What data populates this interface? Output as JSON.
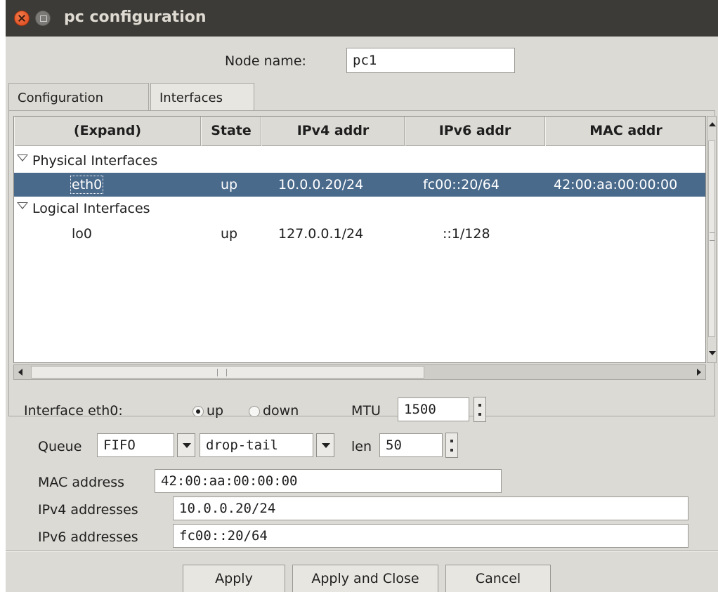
{
  "window": {
    "title": "pc configuration"
  },
  "node_name": {
    "label": "Node name:",
    "value": "pc1"
  },
  "tabs": [
    {
      "label": "Configuration",
      "selected": false
    },
    {
      "label": "Interfaces",
      "selected": true
    }
  ],
  "table": {
    "columns": [
      "(Expand)",
      "State",
      "IPv4 addr",
      "IPv6 addr",
      "MAC addr"
    ],
    "groups": [
      {
        "label": "Physical Interfaces",
        "rows": [
          {
            "name": "eth0",
            "state": "up",
            "ipv4": "10.0.0.20/24",
            "ipv6": "fc00::20/64",
            "mac": "42:00:aa:00:00:00",
            "selected": true
          }
        ]
      },
      {
        "label": "Logical Interfaces",
        "rows": [
          {
            "name": "lo0",
            "state": "up",
            "ipv4": "127.0.0.1/24",
            "ipv6": "::1/128",
            "mac": "",
            "selected": false
          }
        ]
      }
    ]
  },
  "iface_form": {
    "interface_label": "Interface eth0:",
    "up_label": "up",
    "down_label": "down",
    "state_selected": "up",
    "mtu_label": "MTU",
    "mtu_value": "1500",
    "queue_label": "Queue",
    "queue_value": "FIFO",
    "queue_policy": "drop-tail",
    "len_label": "len",
    "len_value": "50",
    "mac_label": "MAC address",
    "mac_value": "42:00:aa:00:00:00",
    "ipv4_label": "IPv4 addresses",
    "ipv4_value": "10.0.0.20/24",
    "ipv6_label": "IPv6 addresses",
    "ipv6_value": "fc00::20/64"
  },
  "buttons": {
    "apply": "Apply",
    "apply_close": "Apply and Close",
    "cancel": "Cancel"
  },
  "colors": {
    "titlebar": "#3c3b37",
    "selection": "#4a6a8c",
    "dialog_bg": "#dcdad5",
    "close_button": "#e1592a"
  }
}
